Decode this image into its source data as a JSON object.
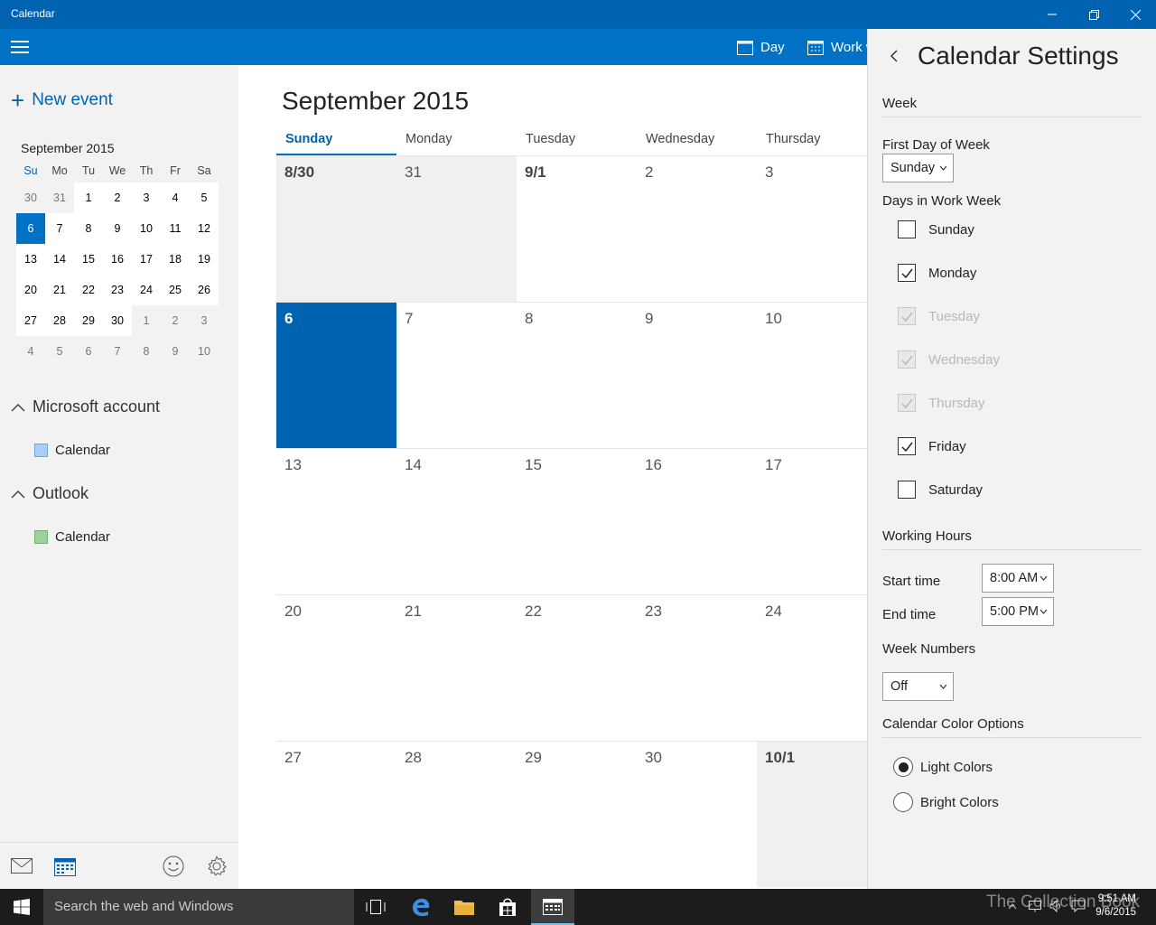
{
  "window": {
    "title": "Calendar"
  },
  "commandbar": {
    "day_label": "Day",
    "workweek_label": "Work w"
  },
  "sidebar": {
    "new_event_label": "New event",
    "mini": {
      "title": "September 2015",
      "dow": [
        "Su",
        "Mo",
        "Tu",
        "We",
        "Th",
        "Fr",
        "Sa"
      ],
      "weeks": [
        [
          "30",
          "31",
          "1",
          "2",
          "3",
          "4",
          "5"
        ],
        [
          "6",
          "7",
          "8",
          "9",
          "10",
          "11",
          "12"
        ],
        [
          "13",
          "14",
          "15",
          "16",
          "17",
          "18",
          "19"
        ],
        [
          "20",
          "21",
          "22",
          "23",
          "24",
          "25",
          "26"
        ],
        [
          "27",
          "28",
          "29",
          "30",
          "1",
          "2",
          "3"
        ],
        [
          "4",
          "5",
          "6",
          "7",
          "8",
          "9",
          "10"
        ]
      ]
    },
    "accounts": [
      {
        "name": "Microsoft account",
        "calendar": "Calendar",
        "color": "#a9cff5"
      },
      {
        "name": "Outlook",
        "calendar": "Calendar",
        "color": "#9ad29a"
      }
    ]
  },
  "main": {
    "month_title": "September 2015",
    "dow": [
      "Sunday",
      "Monday",
      "Tuesday",
      "Wednesday",
      "Thursday"
    ],
    "weeks": [
      [
        "8/30",
        "31",
        "9/1",
        "2",
        "3"
      ],
      [
        "6",
        "7",
        "8",
        "9",
        "10"
      ],
      [
        "13",
        "14",
        "15",
        "16",
        "17"
      ],
      [
        "20",
        "21",
        "22",
        "23",
        "24"
      ],
      [
        "27",
        "28",
        "29",
        "30",
        "10/1"
      ]
    ]
  },
  "settings": {
    "title": "Calendar Settings",
    "week_heading": "Week",
    "first_day_label": "First Day of Week",
    "first_day_value": "Sunday",
    "work_week_label": "Days in Work Week",
    "days": [
      {
        "label": "Sunday",
        "checked": false,
        "disabled": false
      },
      {
        "label": "Monday",
        "checked": true,
        "disabled": false
      },
      {
        "label": "Tuesday",
        "checked": true,
        "disabled": true
      },
      {
        "label": "Wednesday",
        "checked": true,
        "disabled": true
      },
      {
        "label": "Thursday",
        "checked": true,
        "disabled": true
      },
      {
        "label": "Friday",
        "checked": true,
        "disabled": false
      },
      {
        "label": "Saturday",
        "checked": false,
        "disabled": false
      }
    ],
    "working_hours_heading": "Working Hours",
    "start_label": "Start time",
    "start_value": "8:00 AM",
    "end_label": "End time",
    "end_value": "5:00 PM",
    "week_numbers_heading": "Week Numbers",
    "week_numbers_value": "Off",
    "color_heading": "Calendar Color Options",
    "light_label": "Light Colors",
    "bright_label": "Bright Colors"
  },
  "taskbar": {
    "search_placeholder": "Search the web and Windows",
    "time": "9:51 AM",
    "date": "9/6/2015",
    "watermark": "The Collection Book"
  }
}
